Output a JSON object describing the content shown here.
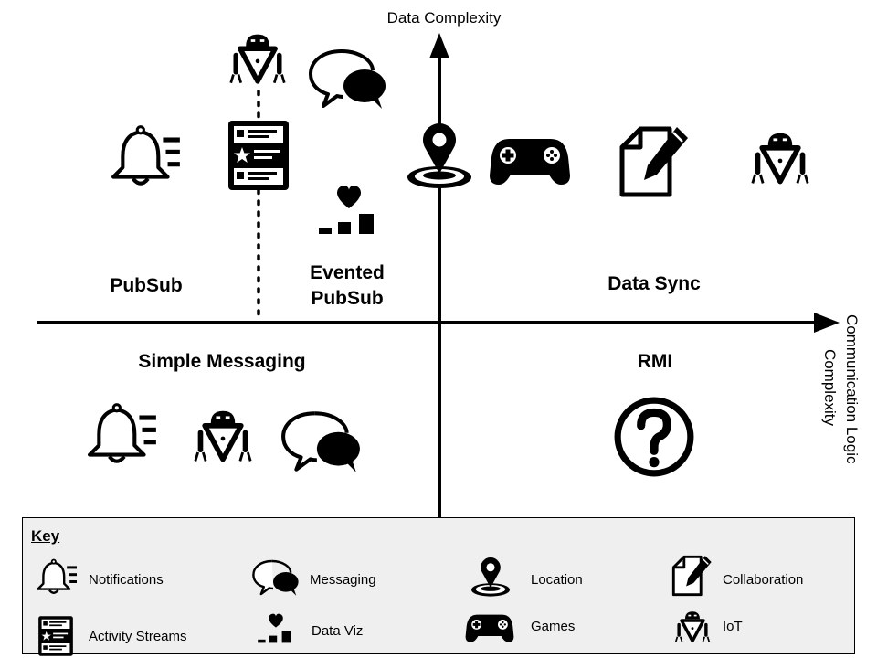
{
  "axes": {
    "y_label": "Data Complexity",
    "x_label_line1": "Communication Logic",
    "x_label_line2": "Complexity"
  },
  "quadrants": {
    "pubsub": "PubSub",
    "evented_line1": "Evented",
    "evented_line2": "PubSub",
    "data_sync": "Data Sync",
    "simple_messaging": "Simple Messaging",
    "rmi": "RMI"
  },
  "key": {
    "title": "Key",
    "items": {
      "notifications": "Notifications",
      "messaging": "Messaging",
      "location": "Location",
      "collaboration": "Collaboration",
      "activity_streams": "Activity Streams",
      "data_viz": "Data Viz",
      "games": "Games",
      "iot": "IoT"
    }
  },
  "colors": {
    "ink": "#000000",
    "key_background": "#efefef",
    "page_background": "#ffffff"
  },
  "icons": [
    "bell-icon",
    "speech-bubbles-icon",
    "robot-icon",
    "activity-stream-icon",
    "data-viz-icon",
    "location-pin-icon",
    "gamepad-icon",
    "document-pencil-icon",
    "question-icon"
  ]
}
